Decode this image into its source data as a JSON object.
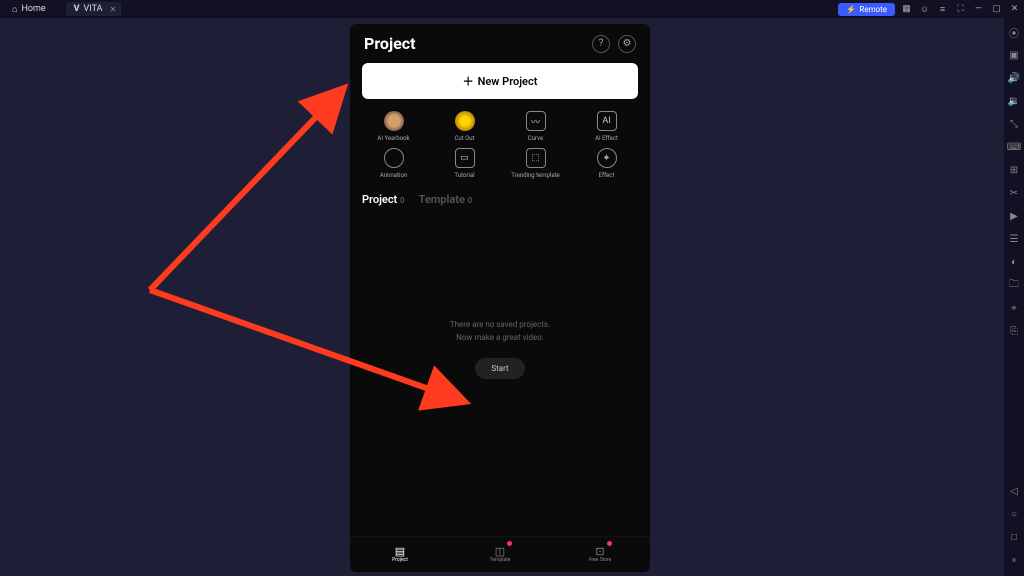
{
  "topbar": {
    "home_label": "Home",
    "app_tab_label": "VITA",
    "remote_label": "Remote"
  },
  "phone": {
    "title": "Project",
    "new_project_label": "New Project",
    "features": [
      {
        "label": "AI Yearbook"
      },
      {
        "label": "Cut Out"
      },
      {
        "label": "Curve"
      },
      {
        "label": "AI Effect"
      },
      {
        "label": "Animation"
      },
      {
        "label": "Tutorial"
      },
      {
        "label": "Trending template"
      },
      {
        "label": "Effect"
      }
    ],
    "segment": {
      "project_label": "Project",
      "project_count": "0",
      "template_label": "Template",
      "template_count": "0"
    },
    "empty": {
      "line1": "There are no saved projects.",
      "line2": "Now make a great video.",
      "start_label": "Start"
    },
    "bottomnav": {
      "project": "Project",
      "template": "Template",
      "freestore": "Free Store"
    }
  }
}
